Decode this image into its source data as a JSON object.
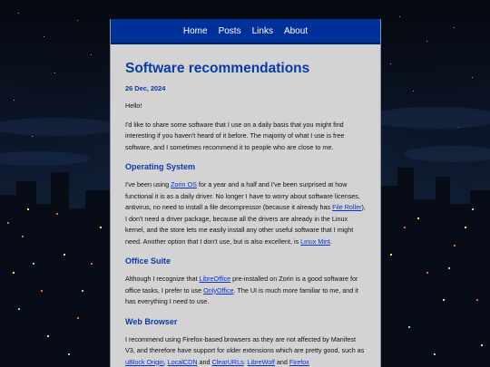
{
  "nav": {
    "items": [
      "Home",
      "Posts",
      "Links",
      "About"
    ]
  },
  "post": {
    "title": "Software recommendations",
    "date": "26 Dec, 2024",
    "greeting": "Hello!",
    "intro": "I'd like to share some software that I use on a daily basis that you might find interesting if you haven't heard of it before. The majority of what I use is free software, and I sometimes recommend it to people who are close to me."
  },
  "sections": {
    "os": {
      "heading": "Operating System",
      "t1": "I've been using ",
      "link1": "Zorin OS",
      "t2": " for a year and a half and I've been surprised at how functional it is as a daily driver. No longer I have to worry about software licenses, antivirus, no need to install a file decompressor (because it already has ",
      "link2": "File Roller",
      "t3": "), I don't need a driver package, because all the drivers are already in the Linux kernel, and the store lets me easily install any other useful software that I might need. Another option that I don't use, but is also excellent, is ",
      "link3": "Linux Mint",
      "t4": "."
    },
    "office": {
      "heading": "Office Suite",
      "t1": "Although I recognize that ",
      "link1": "LibreOffice",
      "t2": " pre-installed on Zorin is a good software for office tasks, I prefer to use ",
      "link2": "OnlyOffice",
      "t3": ". The UI is much more familiar to me, and it has everything I need to use."
    },
    "browser": {
      "heading": "Web Browser",
      "t1": "I recommend using Firefox-based browsers as they are not affected by Manifest V3, and therefore have support for older extensions which are pretty good, such as ",
      "link1": "uBlock Origin",
      "t2": ", ",
      "link2": "LocalCDN",
      "t3": " and ",
      "link3": "ClearURLs",
      "t4": ". ",
      "link4": "LibreWolf",
      "t5": " and ",
      "link5": "Firefox"
    }
  },
  "colors": {
    "nav_bg": "#00309a",
    "heading": "#0a3aa8",
    "link": "#0b2fd0",
    "panel": "#d3d3d3"
  }
}
